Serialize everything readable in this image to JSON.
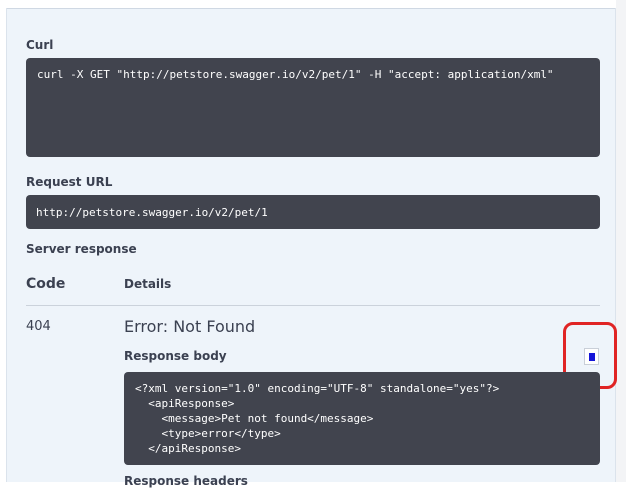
{
  "curl": {
    "label": "Curl",
    "command": "curl -X GET \"http://petstore.swagger.io/v2/pet/1\" -H \"accept: application/xml\""
  },
  "request_url": {
    "label": "Request URL",
    "value": "http://petstore.swagger.io/v2/pet/1"
  },
  "server_response": {
    "label": "Server response",
    "columns": {
      "code": "Code",
      "details": "Details"
    },
    "code": "404",
    "status_text": "Error: Not Found",
    "response_body_label": "Response body",
    "response_body": "<?xml version=\"1.0\" encoding=\"UTF-8\" standalone=\"yes\"?>\n  <apiResponse>\n    <message>Pet not found</message>\n    <type>error</type>\n  </apiResponse>",
    "response_headers_label": "Response headers"
  },
  "icons": {
    "copy": "copy-icon"
  },
  "colors": {
    "code_background": "#41444e",
    "panel_background": "#eef4fa",
    "highlight": "#e02424",
    "copy_glyph": "#1515d8"
  }
}
